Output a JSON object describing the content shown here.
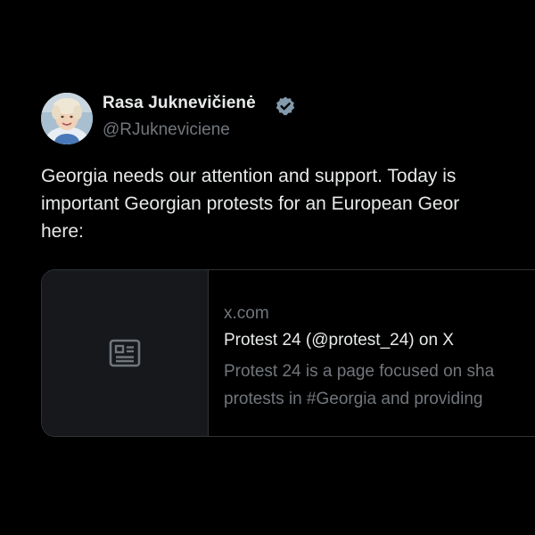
{
  "tweet": {
    "author": {
      "name": "Rasa Juknevičienė",
      "handle": "@RJukneviciene",
      "verified": true,
      "verified_color": "#829aab"
    },
    "text_lines": [
      "Georgia needs our attention and support. Today is",
      "important Georgian protests for an European Geor",
      "here:"
    ],
    "link_card": {
      "domain": "x.com",
      "title": "Protest 24 (@protest_24) on X",
      "description_lines": [
        "Protest 24 is a page focused on sha",
        "protests in #Georgia and providing"
      ],
      "thumbnail_icon": "newspaper-icon"
    }
  },
  "theme": {
    "background": "#000000",
    "text_primary": "#e7e9ea",
    "text_secondary": "#71767b",
    "border": "#2f3336",
    "card_thumb_bg": "#16181c"
  }
}
